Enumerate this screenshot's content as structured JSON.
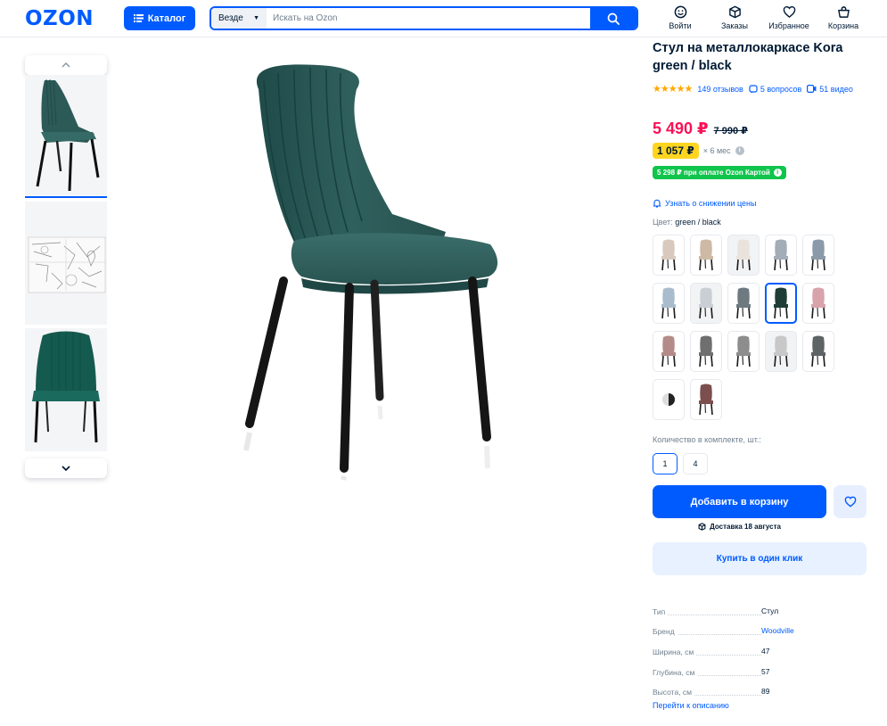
{
  "header": {
    "logo": "OZON",
    "catalog_label": "Каталог",
    "search_scope": "Везде",
    "search_placeholder": "Искать на Ozon",
    "nav": [
      {
        "label": "Войти",
        "icon": "user-icon"
      },
      {
        "label": "Заказы",
        "icon": "box-icon"
      },
      {
        "label": "Избранное",
        "icon": "heart-icon"
      },
      {
        "label": "Корзина",
        "icon": "cart-icon"
      }
    ]
  },
  "gallery": {
    "thumbnails": [
      "chair-angle-view",
      "assembly-diagram",
      "chair-front-view"
    ],
    "active_index": 0
  },
  "product": {
    "title": "Стул на металлокаркасе Kora green / black",
    "rating_stars": 5,
    "reviews": "149 отзывов",
    "questions": "5 вопросов",
    "videos": "51 видео",
    "price": "5 490 ₽",
    "old_price": "7 990 ₽",
    "installment": "1 057 ₽",
    "installment_term": "× 6 мес",
    "card_price": "5 298 ₽ при оплате Ozon Картой",
    "notify": "Узнать о снижении цены",
    "color_label": "Цвет:",
    "color_value": "green / black",
    "swatch_colors": [
      "#d9c9bd",
      "#cdb9a4",
      "#e9e3dc",
      "#a3adb8",
      "#8a9aa8",
      "#a9bccd",
      "#c9cfd4",
      "#6d7a80",
      "#1e3d36",
      "#d9a3ab",
      "#b48b88",
      "#6f6f6f",
      "#8d8d8d",
      "#c8c8c8",
      "#5e6466",
      "two-tone",
      "#7d4e4e"
    ],
    "selected_swatch": 8,
    "quantity_label": "Количество в комплекте, шт.:",
    "quantities": [
      "1",
      "4"
    ],
    "selected_quantity": 0,
    "add_to_cart": "Добавить в корзину",
    "delivery": "Доставка 18 августа",
    "buy_one_click": "Купить в один клик",
    "specs": [
      {
        "name": "Тип",
        "value": "Стул",
        "link": false
      },
      {
        "name": "Бренд",
        "value": "Woodville",
        "link": true
      },
      {
        "name": "Ширина, см",
        "value": "47",
        "link": false
      },
      {
        "name": "Глубина, см",
        "value": "57",
        "link": false
      },
      {
        "name": "Высота, см",
        "value": "89",
        "link": false
      }
    ],
    "to_description": "Перейти к описанию"
  },
  "colors": {
    "accent": "#005bff",
    "price": "#f91155",
    "installment": "#ffd520",
    "card_badge": "#10c44c",
    "chair_green": "#2c5a57"
  }
}
